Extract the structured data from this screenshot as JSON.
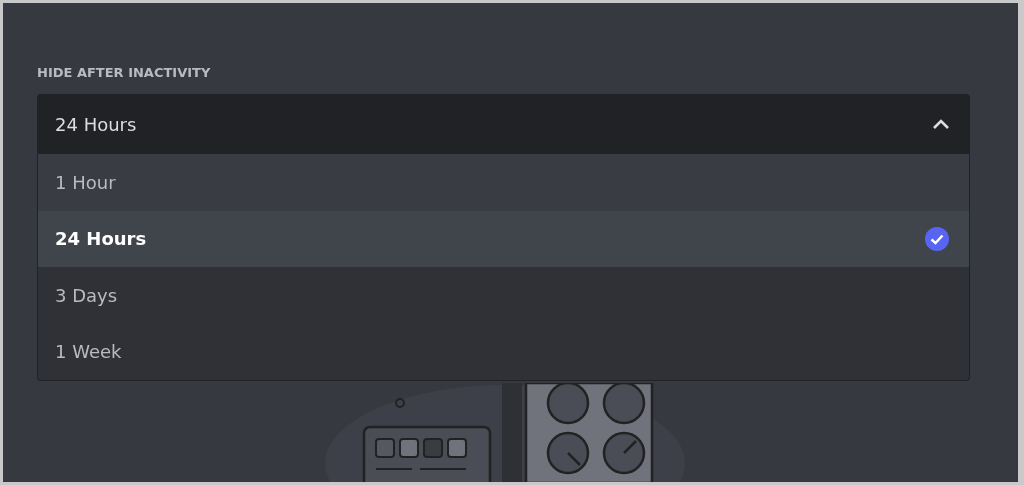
{
  "field_label": "HIDE AFTER INACTIVITY",
  "select": {
    "value": "24 Hours",
    "expanded": true,
    "options": [
      {
        "label": "1 Hour",
        "selected": false,
        "highlighted": true
      },
      {
        "label": "24 Hours",
        "selected": true,
        "highlighted": false
      },
      {
        "label": "3 Days",
        "selected": false,
        "highlighted": false
      },
      {
        "label": "1 Week",
        "selected": false,
        "highlighted": false
      }
    ]
  }
}
